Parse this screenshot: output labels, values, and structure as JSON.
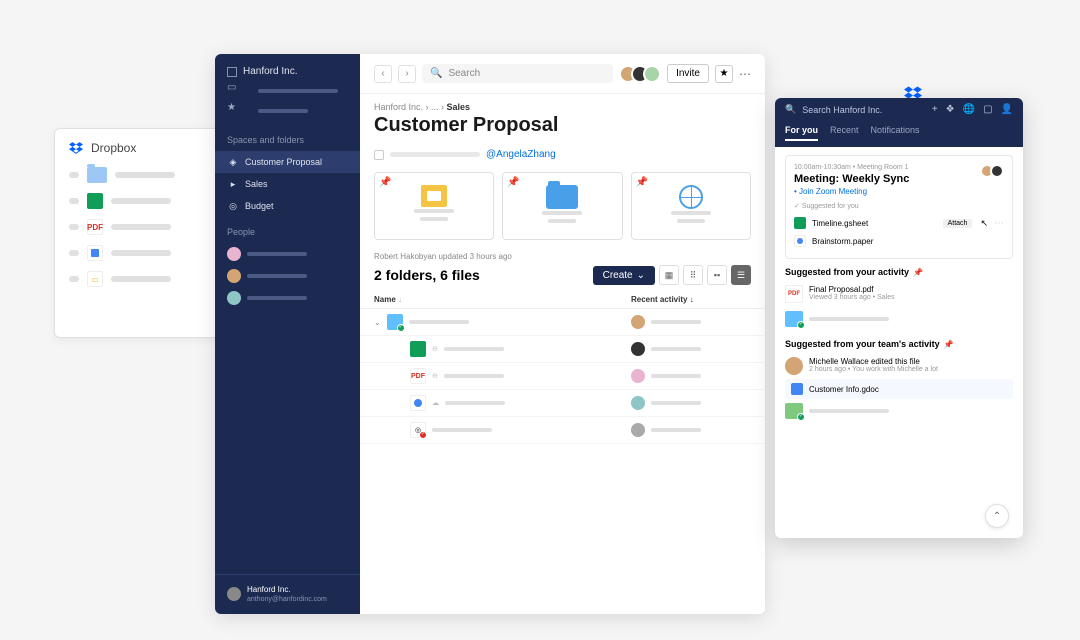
{
  "back_window": {
    "title": "Dropbox"
  },
  "sidebar": {
    "org": "Hanford Inc.",
    "section_spaces": "Spaces and folders",
    "items": [
      {
        "icon": "cube",
        "label": "Customer Proposal",
        "active": true
      },
      {
        "icon": "folder",
        "label": "Sales"
      },
      {
        "icon": "budget",
        "label": "Budget"
      }
    ],
    "section_people": "People",
    "footer_org": "Hanford Inc.",
    "footer_email": "anthony@hanfordinc.com"
  },
  "topbar": {
    "search_placeholder": "Search",
    "invite": "Invite"
  },
  "breadcrumb": {
    "root": "Hanford Inc.",
    "mid": "...",
    "leaf": "Sales"
  },
  "page_title": "Customer Proposal",
  "mention": "@AngelaZhang",
  "update_line": "Robert Hakobyan updated 3 hours ago",
  "summary": "2 folders, 6 files",
  "create_label": "Create",
  "table": {
    "col_name": "Name",
    "col_activity": "Recent activity"
  },
  "panel": {
    "search_placeholder": "Search Hanford Inc.",
    "tabs": [
      "For you",
      "Recent",
      "Notifications"
    ],
    "meeting": {
      "time": "10:00am-10:30am • Meeting Room 1",
      "title": "Meeting: Weekly Sync",
      "join": "Join Zoom Meeting",
      "suggest": "Suggested for you",
      "files": [
        {
          "icon": "gsheet",
          "name": "Timeline.gsheet",
          "attach": "Attach"
        },
        {
          "icon": "paper",
          "name": "Brainstorm.paper"
        }
      ]
    },
    "section_activity": "Suggested from your activity",
    "activity1": {
      "name": "Final Proposal.pdf",
      "sub": "Viewed 3 hours ago • Sales"
    },
    "section_team": "Suggested from your team's activity",
    "team1": {
      "name": "Michelle Wallace edited this file",
      "sub": "2 hours ago • You work with Michelle a lot"
    },
    "team_file": "Customer Info.gdoc"
  }
}
